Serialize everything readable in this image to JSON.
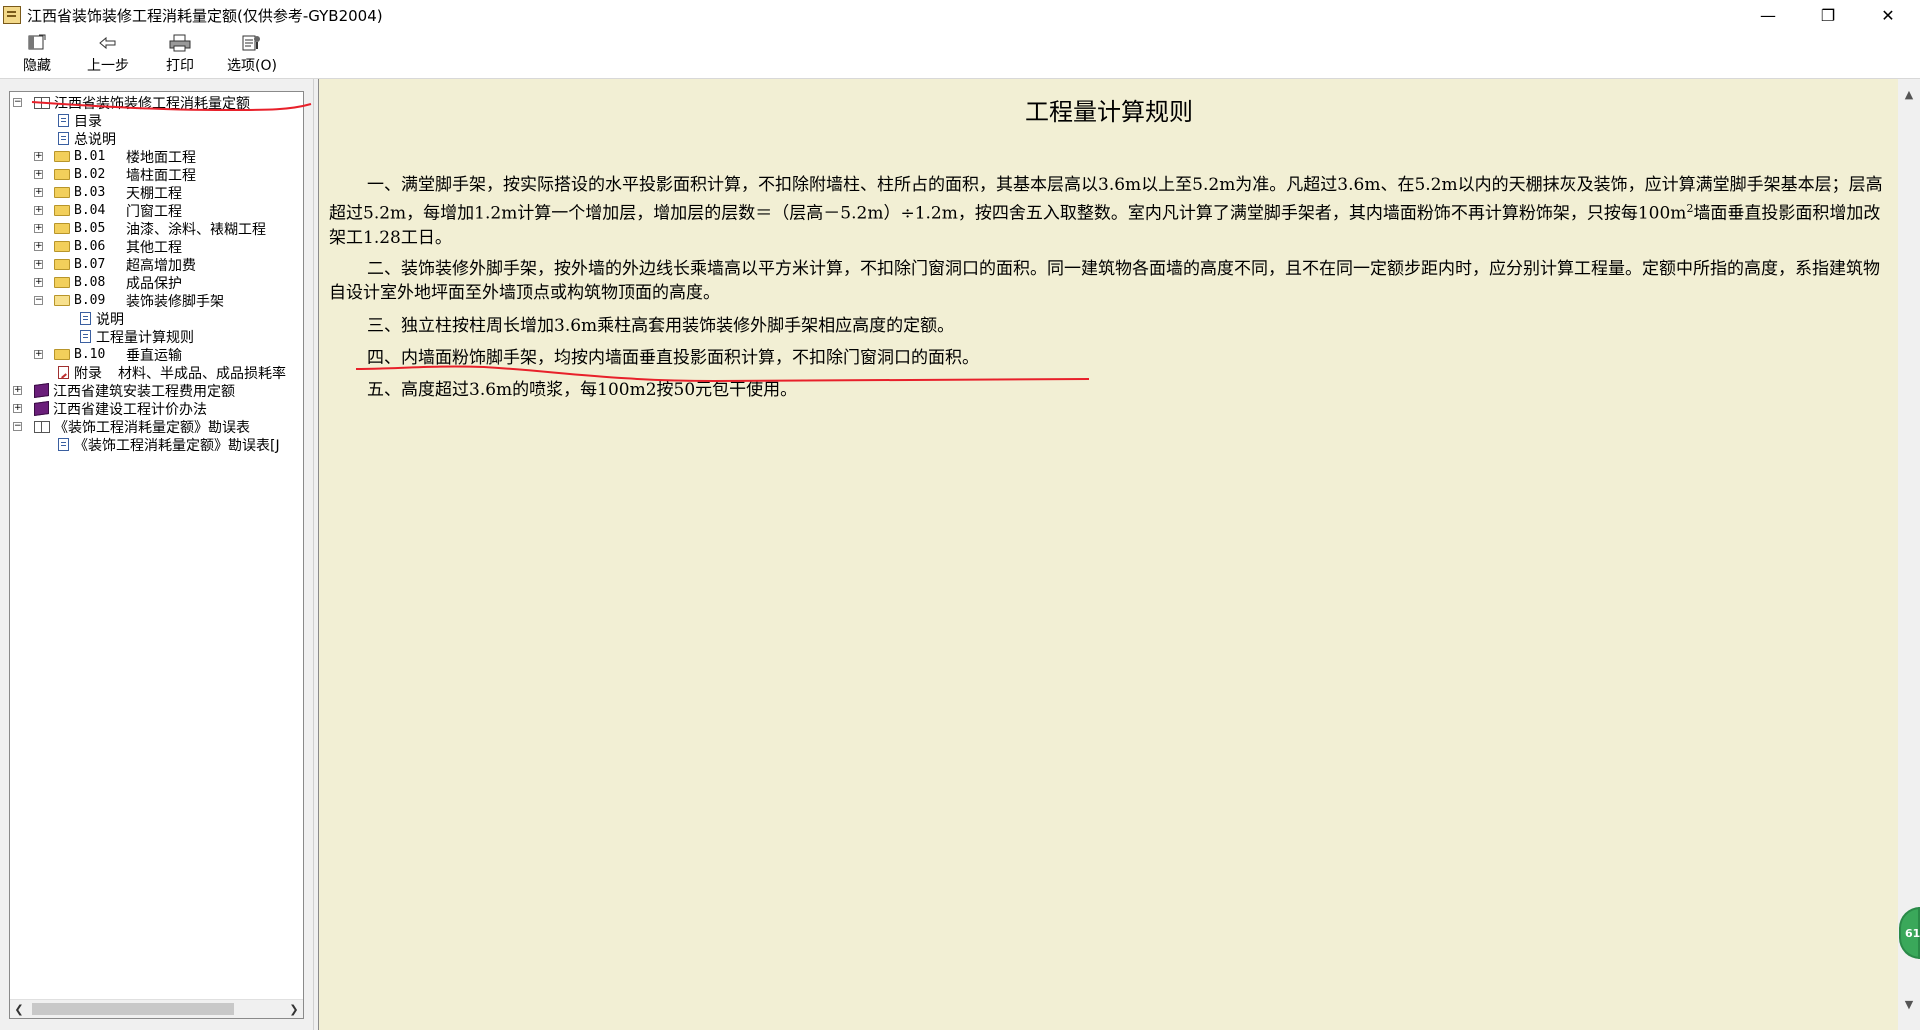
{
  "window": {
    "title": "江西省装饰装修工程消耗量定额(仅供参考-GYB2004)",
    "minimize_glyph": "—",
    "maximize_glyph": "❐",
    "close_glyph": "✕"
  },
  "toolbar": {
    "hide": {
      "label": "隐藏",
      "icon": "hide-icon"
    },
    "back": {
      "label": "上一步",
      "icon": "back-arrow-icon"
    },
    "print": {
      "label": "打印",
      "icon": "printer-icon"
    },
    "options": {
      "label": "选项(O)",
      "icon": "options-icon"
    }
  },
  "tree": {
    "root": "江西省装饰装修工程消耗量定额",
    "toc": "目录",
    "general": "总说明",
    "chapters": [
      {
        "code": "B.01",
        "name": "楼地面工程"
      },
      {
        "code": "B.02",
        "name": "墙柱面工程"
      },
      {
        "code": "B.03",
        "name": "天棚工程"
      },
      {
        "code": "B.04",
        "name": "门窗工程"
      },
      {
        "code": "B.05",
        "name": "油漆、涂料、裱糊工程"
      },
      {
        "code": "B.06",
        "name": "其他工程"
      },
      {
        "code": "B.07",
        "name": "超高增加费"
      },
      {
        "code": "B.08",
        "name": "成品保护"
      },
      {
        "code": "B.09",
        "name": "装饰装修脚手架"
      }
    ],
    "b09_children": [
      "说明",
      "工程量计算规则"
    ],
    "b10": {
      "code": "B.10",
      "name": "垂直运输"
    },
    "appendix": {
      "code": "附录",
      "name": "材料、半成品、成品损耗率"
    },
    "book2": "江西省建筑安装工程费用定额",
    "book3": "江西省建设工程计价办法",
    "book4": "《装饰工程消耗量定额》勘误表",
    "book4_child": "《装饰工程消耗量定额》勘误表[J"
  },
  "document": {
    "title": "工程量计算规则",
    "p1": "一、满堂脚手架，按实际搭设的水平投影面积计算，不扣除附墙柱、柱所占的面积，其基本层高以3.6m以上至5.2m为准。凡超过3.6m、在5.2m以内的天棚抹灰及装饰，应计算满堂脚手架基本层；层高超过5.2m，每增加1.2m计算一个增加层，增加层的层数＝（层高－5.2m）÷1.2m，按四舍五入取整数。室内凡计算了满堂脚手架者，其内墙面粉饰不再计算粉饰架，只按每100m",
    "p1_sup": "2",
    "p1_tail": "墙面垂直投影面积增加改架工1.28工日。",
    "p2": "二、装饰装修外脚手架，按外墙的外边线长乘墙高以平方米计算，不扣除门窗洞口的面积。同一建筑物各面墙的高度不同，且不在同一定额步距内时，应分别计算工程量。定额中所指的高度，系指建筑物自设计室外地坪面至外墙顶点或构筑物顶面的高度。",
    "p3": "三、独立柱按柱周长增加3.6m乘柱高套用装饰装修外脚手架相应高度的定额。",
    "p4": "四、内墙面粉饰脚手架，均按内墙面垂直投影面积计算，不扣除门窗洞口的面积。",
    "p5": "五、高度超过3.6m的喷浆，每100m2按50元包干使用。"
  },
  "badge": {
    "text": "61"
  },
  "colors": {
    "content_bg": "#f2efd4",
    "annotation_red": "#e8202a",
    "badge_green": "#3aa85a"
  }
}
